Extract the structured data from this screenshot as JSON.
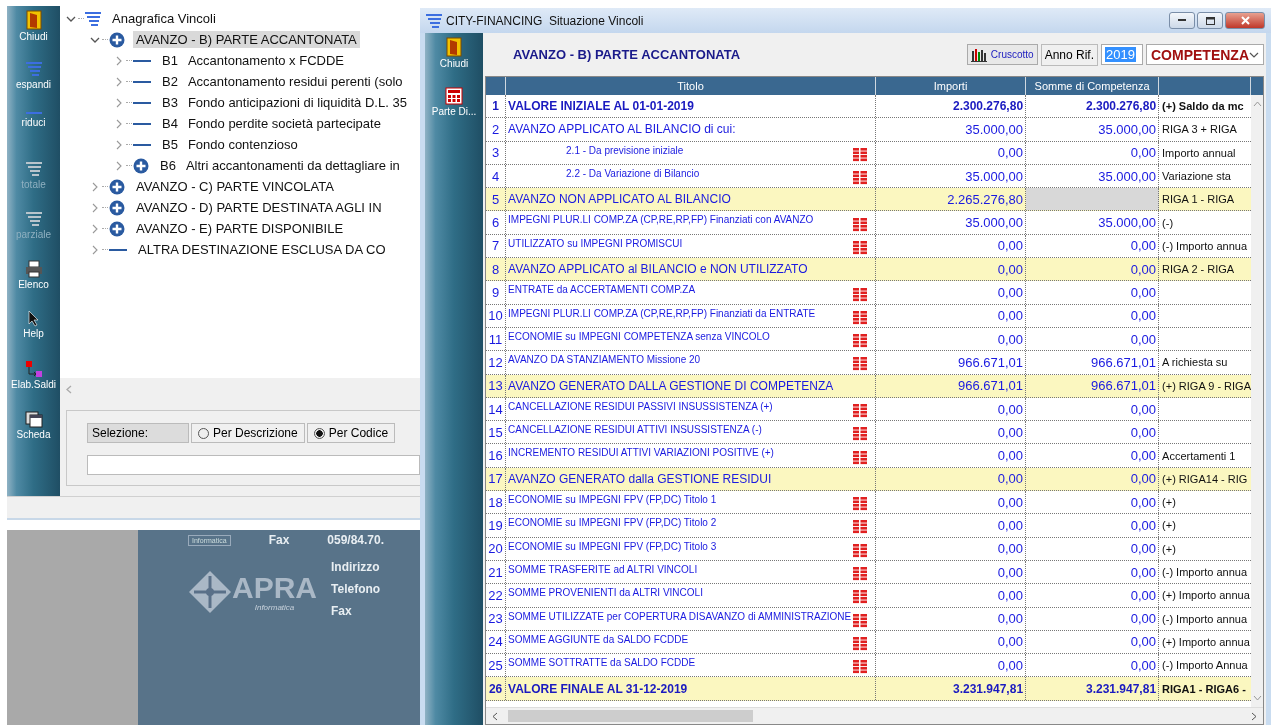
{
  "left_window": {
    "toolbar": [
      {
        "label": "Chiudi",
        "disabled": false
      },
      {
        "label": "espandi",
        "disabled": false
      },
      {
        "label": "riduci",
        "disabled": false
      },
      {
        "label": "totale",
        "disabled": true
      },
      {
        "label": "parziale",
        "disabled": true
      },
      {
        "label": "Elenco",
        "disabled": false
      },
      {
        "label": "Help",
        "disabled": false
      },
      {
        "label": "Elab.Saldi",
        "disabled": false
      },
      {
        "label": "Scheda",
        "disabled": false
      }
    ],
    "tree": [
      {
        "label": "Anagrafica Vincoli",
        "kind": "root",
        "expanded": true,
        "selected": false,
        "children": [
          {
            "label": "AVANZO - B) PARTE ACCANTONATA",
            "kind": "group",
            "expanded": true,
            "selected": true,
            "children": [
              {
                "code": "B1",
                "label": "Accantonamento x FCDDE",
                "kind": "leaf",
                "expanded": false,
                "selected": false
              },
              {
                "code": "B2",
                "label": "Accantonamento residui perenti (solo",
                "kind": "leaf",
                "expanded": false,
                "selected": false
              },
              {
                "code": "B3",
                "label": "Fondo anticipazioni di liquidità D.L. 35",
                "kind": "leaf",
                "expanded": false,
                "selected": false
              },
              {
                "code": "B4",
                "label": "Fondo perdite società partecipate",
                "kind": "leaf",
                "expanded": false,
                "selected": false
              },
              {
                "code": "B5",
                "label": "Fondo contenzioso",
                "kind": "leaf",
                "expanded": false,
                "selected": false
              },
              {
                "code": "B6",
                "label": "Altri accantonamenti da dettagliare in",
                "kind": "group",
                "expanded": false,
                "selected": false
              }
            ]
          },
          {
            "label": "AVANZO - C) PARTE VINCOLATA",
            "kind": "group",
            "expanded": false,
            "selected": false
          },
          {
            "label": "AVANZO - D) PARTE DESTINATA AGLI IN",
            "kind": "group",
            "expanded": false,
            "selected": false
          },
          {
            "label": "AVANZO - E) PARTE DISPONIBILE",
            "kind": "group",
            "expanded": false,
            "selected": false
          },
          {
            "label": "ALTRA DESTINAZIONE ESCLUSA DA CO",
            "kind": "leaf",
            "expanded": false,
            "selected": false
          }
        ]
      }
    ],
    "selection": {
      "label": "Selezione:",
      "options": [
        {
          "label": "Per Descrizione",
          "selected": false
        },
        {
          "label": "Per Codice",
          "selected": true
        }
      ]
    }
  },
  "background_panel": {
    "logo_caption": "Informatica",
    "top_label": "Fax",
    "top_value": "059/84.70.",
    "brand": "APRA",
    "brand_sub": "Informatica",
    "labels": [
      "Indirizzo",
      "Telefono",
      "Fax"
    ]
  },
  "right_window": {
    "title": "CITY-FINANCING  Situazione Vincoli",
    "toolbar": [
      {
        "label": "Chiudi"
      },
      {
        "label": "Parte Di..."
      }
    ],
    "heading": "AVANZO - B) PARTE ACCANTONATA",
    "dashboard_button": "Cruscotto",
    "year_label": "Anno Rif.",
    "year": "2019",
    "mode": "COMPETENZA",
    "columns": [
      "",
      "Titolo",
      "Importi",
      "Somme di Competenza",
      ""
    ],
    "rows": [
      {
        "num": "1",
        "title": "VALORE INIZIALE AL 01-01-2019",
        "kind": "total",
        "highlighted": false,
        "detail": false,
        "importi": "2.300.276,80",
        "somme": "2.300.276,80",
        "somme_disabled": false,
        "note": "(+) Saldo da mc"
      },
      {
        "num": "2",
        "title": "AVANZO APPLICATO AL BILANCIO di cui:",
        "kind": "summary",
        "highlighted": false,
        "detail": false,
        "importi": "35.000,00",
        "somme": "35.000,00",
        "somme_disabled": false,
        "note": "RIGA 3 + RIGA"
      },
      {
        "num": "3",
        "title": "2.1 - Da previsione iniziale",
        "kind": "subitem",
        "highlighted": false,
        "detail": true,
        "importi": "0,00",
        "somme": "0,00",
        "somme_disabled": false,
        "note": "Importo annual"
      },
      {
        "num": "4",
        "title": "2.2 - Da Variazione di Bilancio",
        "kind": "subitem",
        "highlighted": false,
        "detail": true,
        "importi": "35.000,00",
        "somme": "35.000,00",
        "somme_disabled": false,
        "note": "Variazione sta"
      },
      {
        "num": "5",
        "title": "AVANZO NON APPLICATO AL BILANCIO",
        "kind": "summary",
        "highlighted": true,
        "detail": false,
        "importi": "2.265.276,80",
        "somme": "",
        "somme_disabled": true,
        "note": "RIGA 1 -  RIGA"
      },
      {
        "num": "6",
        "title": "IMPEGNI PLUR.LI COMP.ZA (CP,RE,RP,FP) Finanziati con AVANZO",
        "kind": "item",
        "highlighted": false,
        "detail": true,
        "importi": "35.000,00",
        "somme": "35.000,00",
        "somme_disabled": false,
        "note": "(-)"
      },
      {
        "num": "7",
        "title": "UTILIZZATO su IMPEGNI PROMISCUI",
        "kind": "item",
        "highlighted": false,
        "detail": true,
        "importi": "0,00",
        "somme": "0,00",
        "somme_disabled": false,
        "note": "(-) Importo annua"
      },
      {
        "num": "8",
        "title": "AVANZO APPLICATO al BILANCIO e NON UTILIZZATO",
        "kind": "summary",
        "highlighted": true,
        "detail": false,
        "importi": "0,00",
        "somme": "0,00",
        "somme_disabled": false,
        "note": "RIGA 2 - RIGA"
      },
      {
        "num": "9",
        "title": "ENTRATE da ACCERTAMENTI COMP.ZA",
        "kind": "item",
        "highlighted": false,
        "detail": true,
        "importi": "0,00",
        "somme": "0,00",
        "somme_disabled": false,
        "note": ""
      },
      {
        "num": "10",
        "title": "IMPEGNI PLUR.LI COMP.ZA (CP,RE,RP,FP) Finanziati da ENTRATE",
        "kind": "item",
        "highlighted": false,
        "detail": true,
        "importi": "0,00",
        "somme": "0,00",
        "somme_disabled": false,
        "note": ""
      },
      {
        "num": "11",
        "title": "ECONOMIE su IMPEGNI COMPETENZA senza VINCOLO",
        "kind": "item",
        "highlighted": false,
        "detail": true,
        "importi": "0,00",
        "somme": "0,00",
        "somme_disabled": false,
        "note": ""
      },
      {
        "num": "12",
        "title": "AVANZO DA STANZIAMENTO Missione 20",
        "kind": "item",
        "highlighted": false,
        "detail": true,
        "importi": "966.671,01",
        "somme": "966.671,01",
        "somme_disabled": false,
        "note": "A richiesta su"
      },
      {
        "num": "13",
        "title": "AVANZO GENERATO DALLA GESTIONE DI COMPETENZA",
        "kind": "summary",
        "highlighted": true,
        "detail": false,
        "importi": "966.671,01",
        "somme": "966.671,01",
        "somme_disabled": false,
        "note": "(+) RIGA 9 - RIGA"
      },
      {
        "num": "14",
        "title": "CANCELLAZIONE RESIDUI PASSIVI INSUSSISTENZA (+)",
        "kind": "item",
        "highlighted": false,
        "detail": true,
        "importi": "0,00",
        "somme": "0,00",
        "somme_disabled": false,
        "note": ""
      },
      {
        "num": "15",
        "title": "CANCELLAZIONE RESIDUI ATTIVI INSUSSISTENZA (-)",
        "kind": "item",
        "highlighted": false,
        "detail": true,
        "importi": "0,00",
        "somme": "0,00",
        "somme_disabled": false,
        "note": ""
      },
      {
        "num": "16",
        "title": "INCREMENTO RESIDUI ATTIVI VARIAZIONI POSITIVE (+)",
        "kind": "item",
        "highlighted": false,
        "detail": true,
        "importi": "0,00",
        "somme": "0,00",
        "somme_disabled": false,
        "note": "Accertamenti 1"
      },
      {
        "num": "17",
        "title": "AVANZO GENERATO dalla GESTIONE RESIDUI",
        "kind": "summary",
        "highlighted": true,
        "detail": false,
        "importi": "0,00",
        "somme": "0,00",
        "somme_disabled": false,
        "note": "(+) RIGA14 - RIG"
      },
      {
        "num": "18",
        "title": "ECONOMIE su IMPEGNI FPV  (FP,DC) Titolo 1",
        "kind": "item",
        "highlighted": false,
        "detail": true,
        "importi": "0,00",
        "somme": "0,00",
        "somme_disabled": false,
        "note": "(+)"
      },
      {
        "num": "19",
        "title": "ECONOMIE su IMPEGNI FPV  (FP,DC) Titolo 2",
        "kind": "item",
        "highlighted": false,
        "detail": true,
        "importi": "0,00",
        "somme": "0,00",
        "somme_disabled": false,
        "note": "(+)"
      },
      {
        "num": "20",
        "title": "ECONOMIE su IMPEGNI FPV  (FP,DC) Titolo 3",
        "kind": "item",
        "highlighted": false,
        "detail": true,
        "importi": "0,00",
        "somme": "0,00",
        "somme_disabled": false,
        "note": "(+)"
      },
      {
        "num": "21",
        "title": "SOMME TRASFERITE ad ALTRI VINCOLI",
        "kind": "item",
        "highlighted": false,
        "detail": true,
        "importi": "0,00",
        "somme": "0,00",
        "somme_disabled": false,
        "note": "(-) Importo annua"
      },
      {
        "num": "22",
        "title": "SOMME PROVENIENTI da ALTRI VINCOLI",
        "kind": "item",
        "highlighted": false,
        "detail": true,
        "importi": "0,00",
        "somme": "0,00",
        "somme_disabled": false,
        "note": "(+) Importo annua"
      },
      {
        "num": "23",
        "title": "SOMME UTILIZZATE per COPERTURA DISAVANZO di AMMINISTRAZIONE",
        "kind": "item",
        "highlighted": false,
        "detail": true,
        "importi": "0,00",
        "somme": "0,00",
        "somme_disabled": false,
        "note": "(-) Importo annua"
      },
      {
        "num": "24",
        "title": "SOMME AGGIUNTE da SALDO FCDDE",
        "kind": "item",
        "highlighted": false,
        "detail": true,
        "importi": "0,00",
        "somme": "0,00",
        "somme_disabled": false,
        "note": "(+) Importo annua"
      },
      {
        "num": "25",
        "title": "SOMME SOTTRATTE da SALDO FCDDE",
        "kind": "item",
        "highlighted": false,
        "detail": true,
        "importi": "0,00",
        "somme": "0,00",
        "somme_disabled": false,
        "note": "(-) Importo Annua"
      },
      {
        "num": "26",
        "title": "VALORE FINALE AL 31-12-2019",
        "kind": "total",
        "highlighted": true,
        "detail": false,
        "importi": "3.231.947,81",
        "somme": "3.231.947,81",
        "somme_disabled": false,
        "note": "RIGA1 - RIGA6 -"
      }
    ]
  }
}
